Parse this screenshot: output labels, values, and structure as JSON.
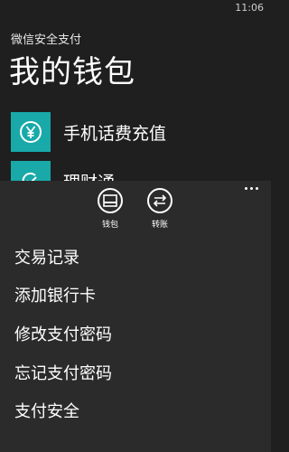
{
  "status": {
    "time": "11:06"
  },
  "app": {
    "title": "微信安全支付"
  },
  "page": {
    "title": "我的钱包"
  },
  "list": {
    "items": [
      {
        "label": "手机话费充值",
        "icon": "yen-icon"
      },
      {
        "label": "理财通",
        "icon": "wallet-check-icon"
      }
    ]
  },
  "app_bar": {
    "buttons": [
      {
        "label": "钱包",
        "icon": "wallet-icon"
      },
      {
        "label": "转账",
        "icon": "transfer-icon"
      }
    ],
    "more_icon": "ellipsis-icon"
  },
  "menu": {
    "items": [
      "交易记录",
      "添加银行卡",
      "修改支付密码",
      "忘记支付密码",
      "支付安全"
    ]
  },
  "colors": {
    "accent": "#19a9a9",
    "background": "#1f1f1f",
    "sheet": "#2b2b2b"
  }
}
